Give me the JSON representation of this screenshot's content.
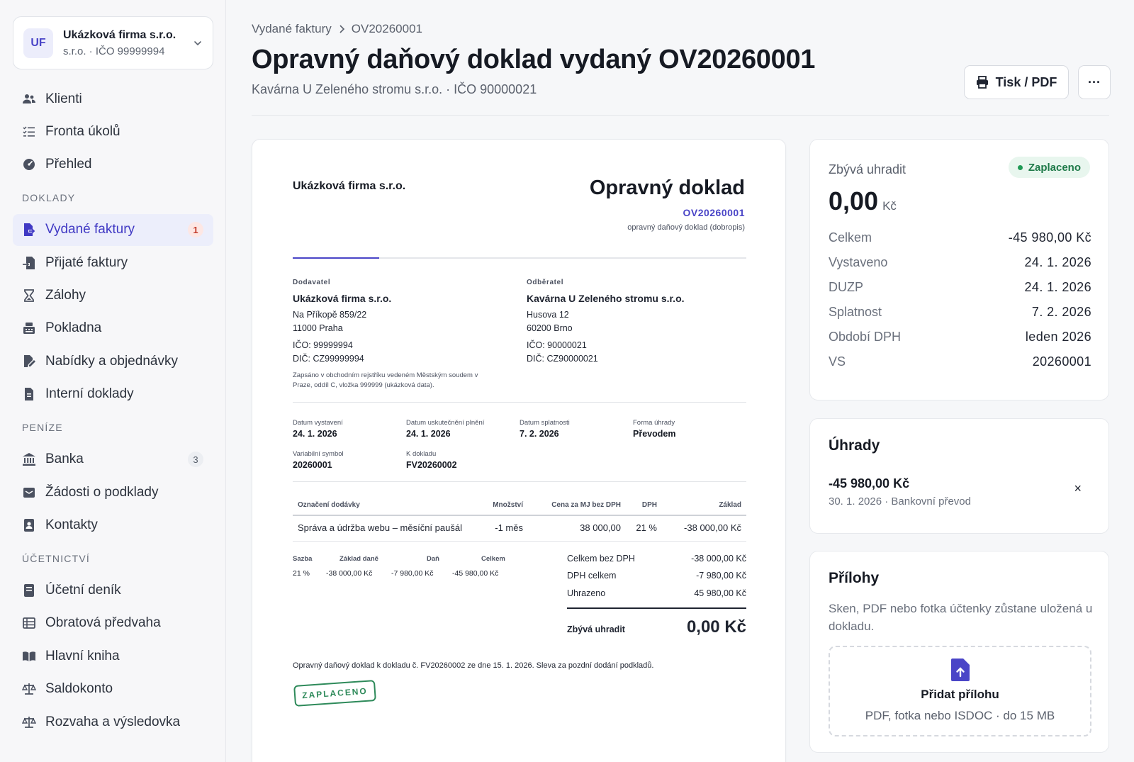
{
  "company": {
    "initials": "UF",
    "name": "Ukázková firma s.r.o.",
    "sub": "s.r.o. · IČO 99999994"
  },
  "nav": {
    "top": [
      {
        "label": "Klienti",
        "icon": "users-icon"
      },
      {
        "label": "Fronta úkolů",
        "icon": "task-list-icon"
      },
      {
        "label": "Přehled",
        "icon": "gauge-icon"
      }
    ],
    "doklady_title": "DOKLADY",
    "doklady": [
      {
        "label": "Vydané faktury",
        "icon": "invoice-out-icon",
        "badge": "1"
      },
      {
        "label": "Přijaté faktury",
        "icon": "invoice-in-icon"
      },
      {
        "label": "Zálohy",
        "icon": "hourglass-icon"
      },
      {
        "label": "Pokladna",
        "icon": "cash-register-icon"
      },
      {
        "label": "Nabídky a objednávky",
        "icon": "signature-icon"
      },
      {
        "label": "Interní doklady",
        "icon": "document-icon"
      }
    ],
    "penize_title": "PENÍZE",
    "penize": [
      {
        "label": "Banka",
        "icon": "bank-icon",
        "badge": "3"
      },
      {
        "label": "Žádosti o podklady",
        "icon": "inbox-icon"
      },
      {
        "label": "Kontakty",
        "icon": "contact-card-icon"
      }
    ],
    "ucetnictvi_title": "ÚČETNICTVÍ",
    "ucetnictvi": [
      {
        "label": "Účetní deník",
        "icon": "journal-icon"
      },
      {
        "label": "Obratová předvaha",
        "icon": "table-icon"
      },
      {
        "label": "Hlavní kniha",
        "icon": "book-icon"
      },
      {
        "label": "Saldokonto",
        "icon": "scale-icon"
      },
      {
        "label": "Rozvaha a výsledovka",
        "icon": "scale-icon"
      }
    ]
  },
  "header": {
    "breadcrumb_parent": "Vydané faktury",
    "breadcrumb_current": "OV20260001",
    "title": "Opravný daňový doklad vydaný OV20260001",
    "subtitle": "Kavárna U Zeleného stromu s.r.o. · IČO 90000021",
    "print_label": "Tisk / PDF",
    "more_label": "···"
  },
  "document": {
    "seller_header": "Ukázková firma s.r.o.",
    "title": "Opravný doklad",
    "number": "OV20260001",
    "kind": "opravný daňový doklad (dobropis)",
    "supplier": {
      "caption": "Dodavatel",
      "name": "Ukázková firma s.r.o.",
      "street": "Na Příkopě 859/22",
      "city": "11000 Praha",
      "ico": "IČO: 99999994",
      "dic": "DIČ: CZ99999994",
      "register": "Zapsáno v obchodním rejstříku vedeném Městským soudem v Praze, oddíl C, vložka 999999 (ukázková data)."
    },
    "customer": {
      "caption": "Odběratel",
      "name": "Kavárna U Zeleného stromu s.r.o.",
      "street": "Husova 12",
      "city": "60200 Brno",
      "ico": "IČO: 90000021",
      "dic": "DIČ: CZ90000021"
    },
    "meta": {
      "issued_label": "Datum vystavení",
      "issued": "24. 1. 2026",
      "taxable_label": "Datum uskutečnění plnění",
      "taxable": "24. 1. 2026",
      "due_label": "Datum splatnosti",
      "due": "7. 2. 2026",
      "payment_label": "Forma úhrady",
      "payment": "Převodem",
      "vs_label": "Variabilní symbol",
      "vs": "20260001",
      "ref_label": "K dokladu",
      "ref": "FV20260002"
    },
    "table": {
      "headers": [
        "Označení dodávky",
        "Množství",
        "Cena za MJ bez DPH",
        "DPH",
        "Základ"
      ],
      "row": [
        "Správa a údržba webu – měsíční paušál",
        "-1 měs",
        "38 000,00",
        "21 %",
        "-38 000,00 Kč"
      ]
    },
    "vat": {
      "headers": [
        "Sazba",
        "Základ daně",
        "Daň",
        "Celkem"
      ],
      "row": [
        "21 %",
        "-38 000,00 Kč",
        "-7 980,00 Kč",
        "-45 980,00 Kč"
      ]
    },
    "summary": {
      "net_label": "Celkem bez DPH",
      "net": "-38 000,00 Kč",
      "vat_label": "DPH celkem",
      "vat": "-7 980,00 Kč",
      "paid_label": "Uhrazeno",
      "paid": "45 980,00 Kč",
      "remaining_label": "Zbývá uhradit",
      "remaining": "0,00 Kč"
    },
    "note": "Opravný daňový doklad k dokladu č. FV20260002 ze dne 15. 1. 2026. Sleva za pozdní dodání podkladů.",
    "stamp": "ZAPLACENO"
  },
  "summary_card": {
    "label": "Zbývá uhradit",
    "status": "Zaplaceno",
    "amount": "0,00",
    "currency": "Kč",
    "rows": [
      {
        "k": "Celkem",
        "v": "-45 980,00 Kč"
      },
      {
        "k": "Vystaveno",
        "v": "24. 1. 2026"
      },
      {
        "k": "DUZP",
        "v": "24. 1. 2026"
      },
      {
        "k": "Splatnost",
        "v": "7. 2. 2026"
      },
      {
        "k": "Období DPH",
        "v": "leden 2026"
      },
      {
        "k": "VS",
        "v": "20260001"
      }
    ]
  },
  "payments_card": {
    "title": "Úhrady",
    "amount": "-45 980,00 Kč",
    "meta": "30. 1. 2026 · Bankovní převod",
    "remove": "×"
  },
  "attachments_card": {
    "title": "Přílohy",
    "description": "Sken, PDF nebo fotka účtenky zůstane uložená u dokladu.",
    "drop_title": "Přidat přílohu",
    "drop_hint": "PDF, fotka nebo ISDOC · do 15 MB"
  },
  "colors": {
    "accent": "#4a45c7",
    "paid": "#1f7a49",
    "badge_red": "#c23a2a"
  }
}
